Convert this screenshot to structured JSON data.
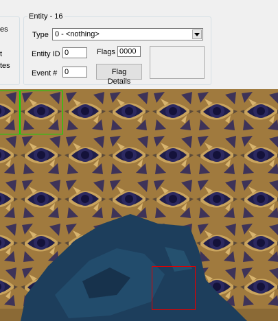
{
  "left_panel": {
    "clipped_labels": [
      "es",
      "t",
      "tes"
    ]
  },
  "entity_group": {
    "title": "Entity - 16",
    "type_label": "Type",
    "type_value": "0 - <nothing>",
    "entity_id_label": "Entity ID",
    "entity_id_value": "0",
    "flags_label": "Flags",
    "flags_value": "0000",
    "event_label": "Event #",
    "event_value": "0",
    "flag_details_button": "Flag Details"
  },
  "icons": {
    "combo_arrow": "dropdown-arrow-icon"
  },
  "colors": {
    "panel_bg": "#f0f0f0",
    "tile_gold": "#b08a45",
    "tile_dark": "#1f1d4a",
    "water": "#1d3e5c",
    "hover_selection": "#00e000",
    "cursor_selection": "#e00000"
  },
  "map": {
    "tileset": "eye-tiles"
  }
}
